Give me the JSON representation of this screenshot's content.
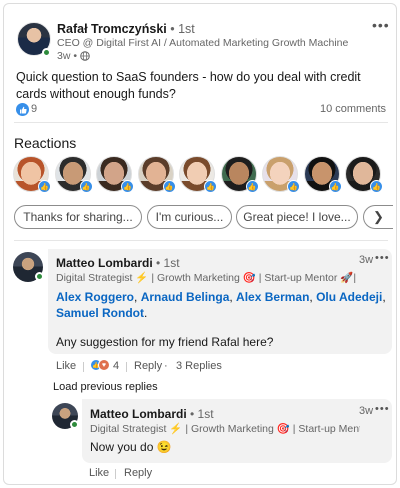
{
  "post": {
    "author_name": "Rafał Tromczyński",
    "author_degree": "• 1st",
    "author_headline": "CEO @ Digital First AI / Automated Marketing Growth Machine",
    "time": "3w •",
    "more_icon": "more-horizontal-icon",
    "text": "Quick question to SaaS founders - how do you deal with credit cards without enough funds?",
    "likes": "9",
    "comments": "10 comments"
  },
  "reactions": {
    "title": "Reactions",
    "people": [
      {
        "name": "reactor-1",
        "hair": "#b8542a",
        "skin": "#f0c4a4",
        "bg": "#e9e2d8"
      },
      {
        "name": "reactor-2",
        "hair": "#2c2c2c",
        "skin": "#c89a76",
        "bg": "#dfe3e6"
      },
      {
        "name": "reactor-3",
        "hair": "#3a2a20",
        "skin": "#d2a489",
        "bg": "#cdd2d6"
      },
      {
        "name": "reactor-4",
        "hair": "#5b3d2a",
        "skin": "#e2b394",
        "bg": "#d9d2c5"
      },
      {
        "name": "reactor-5",
        "hair": "#7a4b2c",
        "skin": "#f1cdb3",
        "bg": "#ece9e4"
      },
      {
        "name": "reactor-6",
        "hair": "#1e1e1e",
        "skin": "#b9865f",
        "bg": "#3f6b4e"
      },
      {
        "name": "reactor-7",
        "hair": "#c9a06c",
        "skin": "#f4d3bd",
        "bg": "#e6e0ea"
      },
      {
        "name": "reactor-8",
        "hair": "#111111",
        "skin": "#c8946c",
        "bg": "#2b3a55"
      },
      {
        "name": "reactor-9",
        "hair": "#1a1a1a",
        "skin": "#e0b79a",
        "bg": "#2a2a2a"
      }
    ]
  },
  "quick_replies": [
    "Thanks for sharing...",
    "I'm curious...",
    "Great piece! I love..."
  ],
  "comment1": {
    "name": "Matteo Lombardi",
    "degree": "• 1st",
    "headline": "Digital Strategist ⚡ | Growth Marketing 🎯 | Start-up Mentor 🚀| L...",
    "time": "3w",
    "mentions": [
      "Alex Roggero",
      "Arnaud Belinga",
      "Alex Berman",
      "Olu Adedeji",
      "Samuel Rondot"
    ],
    "body": "Any suggestion for my friend Rafal here?",
    "like_label": "Like",
    "reaction_count": "4",
    "reply_label": "Reply",
    "replies_label": "3 Replies"
  },
  "load_previous": "Load previous replies",
  "comment2": {
    "name": "Matteo Lombardi",
    "degree": "• 1st",
    "headline": "Digital Strategist ⚡ | Growth Marketing 🎯 | Start-up Ment...",
    "time": "3w",
    "body": "Now you do 😉",
    "like_label": "Like",
    "reply_label": "Reply"
  },
  "colors": {
    "link": "#0a66c2",
    "like_blue": "#378fe9",
    "online_green": "#2e8b3c"
  }
}
